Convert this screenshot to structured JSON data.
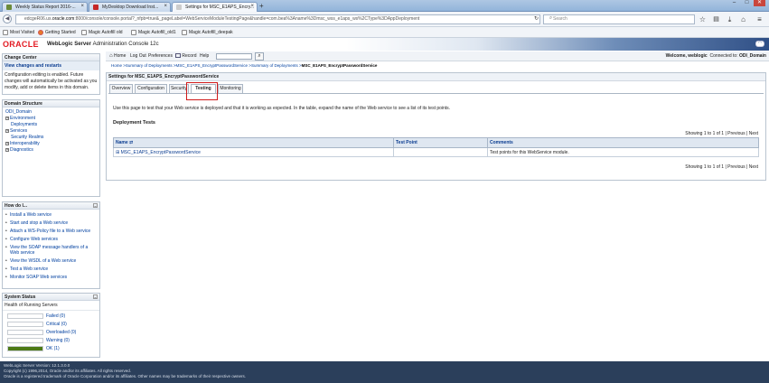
{
  "browser": {
    "tabs": [
      {
        "label": "Weekly Status Report 2016-...",
        "favicon_color": "#6b8a3a"
      },
      {
        "label": "MyDesktop Download Inst...",
        "favicon_color": "#c62828"
      },
      {
        "label": "Settings for MSC_E1APS_Encry...",
        "favicon_color": "#cccccc"
      }
    ],
    "new_tab_label": "+",
    "window_controls": [
      "–",
      "□",
      "✕"
    ],
    "url_prefix": "edcgeR06.us.",
    "url_domain": "oracle.com",
    "url_rest": ":8000/console/console.portal?_nfpb=true&_pageLabel=WebServiceModuleTestingPage&handle=com.bea%3Aname%3Dmsc_wss_e1aps_ws%2CType%3DAppDeployment",
    "search_placeholder": "Search",
    "bookmarks": [
      "Most Visited",
      "Getting Started",
      "Magic Autofill old",
      "Magic Autofill_old1",
      "Magic Autofill_deepak"
    ]
  },
  "header": {
    "logo": "ORACLE",
    "product": "WebLogic Server",
    "product_sub": "Administration Console 12c"
  },
  "toolbar": {
    "items": [
      "Home",
      "Log Out",
      "Preferences",
      "Record",
      "Help"
    ],
    "welcome_prefix": "Welcome, weblogic",
    "connected_prefix": "Connected to:",
    "domain": "ODI_Domain"
  },
  "breadcrumb": {
    "trail": "Home >Summary of Deployments >MSC_E1APS_EncryptPasswordService >Summary of Deployments >",
    "current": "MSC_E1APS_EncryptPasswordService"
  },
  "change_center": {
    "title": "Change Center",
    "link": "View changes and restarts",
    "text": "Configuration editing is enabled. Future changes will automatically be activated as you modify, add or delete items in this domain."
  },
  "domain_structure": {
    "title": "Domain Structure",
    "root": "ODI_Domain",
    "items": [
      {
        "label": "Environment",
        "expandable": true
      },
      {
        "label": "Deployments",
        "expandable": false
      },
      {
        "label": "Services",
        "expandable": true
      },
      {
        "label": "Security Realms",
        "expandable": false
      },
      {
        "label": "Interoperability",
        "expandable": true
      },
      {
        "label": "Diagnostics",
        "expandable": true
      }
    ]
  },
  "how_do_i": {
    "title": "How do I...",
    "items": [
      "Install a Web service",
      "Start and stop a Web service",
      "Attach a WS-Policy file to a Web service",
      "Configure Web services",
      "View the SOAP message handlers of a Web service",
      "View the WSDL of a Web service",
      "Test a Web service",
      "Monitor SOAP Web services"
    ]
  },
  "system_status": {
    "title": "System Status",
    "health_title": "Health of Running Servers",
    "rows": [
      {
        "label": "Failed (0)",
        "fraction": 0
      },
      {
        "label": "Critical (0)",
        "fraction": 0
      },
      {
        "label": "Overloaded (0)",
        "fraction": 0
      },
      {
        "label": "Warning (0)",
        "fraction": 0
      },
      {
        "label": "OK (1)",
        "fraction": 1
      }
    ]
  },
  "main": {
    "title": "Settings for MSC_E1APS_EncryptPasswordService",
    "tabs": [
      "Overview",
      "Configuration",
      "Security",
      "Testing",
      "Monitoring"
    ],
    "selected_tab": "Testing",
    "description": "Use this page to test that your Web service is deployed and that it is working as expected. In the table, expand the name of the Web service to see a list of its test points.",
    "section_title": "Deployment Tests",
    "pager": {
      "showing": "Showing 1 to 1 of 1",
      "previous": "Previous",
      "separator": "|",
      "next": "Next"
    },
    "columns": [
      "Name ⇄",
      "Test Point",
      "Comments"
    ],
    "rows": [
      {
        "name": "⊞ MSC_E1APS_EncryptPasswordService",
        "test_point": "",
        "comments": "Test points for this WebService module."
      }
    ]
  },
  "footer": {
    "version": "WebLogic Server Version: 12.1.3.0.0",
    "copyright": "Copyright (c) 1996,2014, Oracle and/or its affiliates. All rights reserved.",
    "trademark": "Oracle is a registered trademark of Oracle Corporation and/or its affiliates. Other names may be trademarks of their respective owners."
  }
}
